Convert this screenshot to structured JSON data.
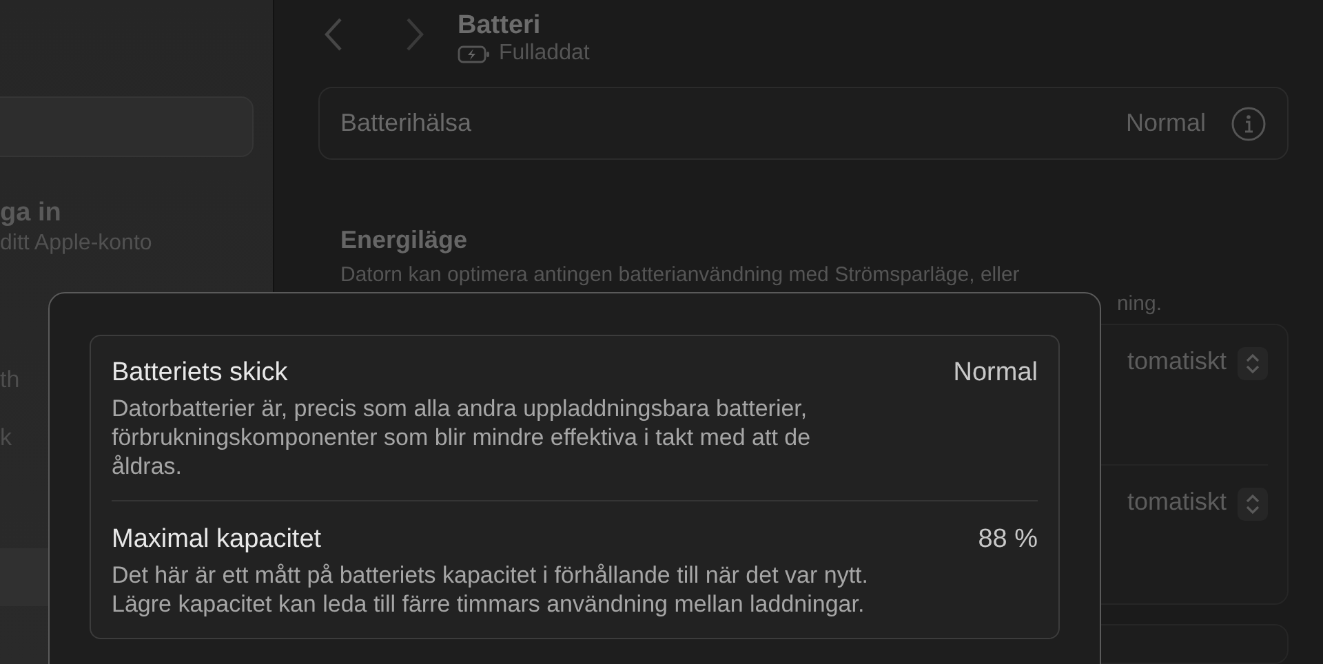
{
  "sidebar": {
    "account": {
      "title": "ga in",
      "subtitle": "ditt Apple-konto"
    },
    "items": [
      {
        "label": "th",
        "selected": false
      },
      {
        "label": "k",
        "selected": false
      },
      {
        "selected": true
      }
    ]
  },
  "header": {
    "title": "Batteri",
    "subtitle": "Fulladdat"
  },
  "battery_health": {
    "label": "Batterihälsa",
    "value": "Normal"
  },
  "energy_mode": {
    "title": "Energiläge",
    "description_lines": [
      "Datorn kan optimera antingen batterianvändning med Strömsparläge, eller",
      "ning."
    ],
    "rows": [
      {
        "value": "tomatiskt"
      },
      {
        "value": "tomatiskt"
      }
    ]
  },
  "sheet": {
    "rows": [
      {
        "title": "Batteriets skick",
        "value": "Normal",
        "description": "Datorbatterier är, precis som alla andra uppladdningsbara batterier, förbrukningskomponenter som blir mindre effektiva i takt med att de åldras."
      },
      {
        "title": "Maximal kapacitet",
        "value": "88 %",
        "description": "Det här är ett mått på batteriets kapacitet i förhållande till när det var nytt. Lägre kapacitet kan leda till färre timmars användning mellan laddningar."
      }
    ]
  }
}
